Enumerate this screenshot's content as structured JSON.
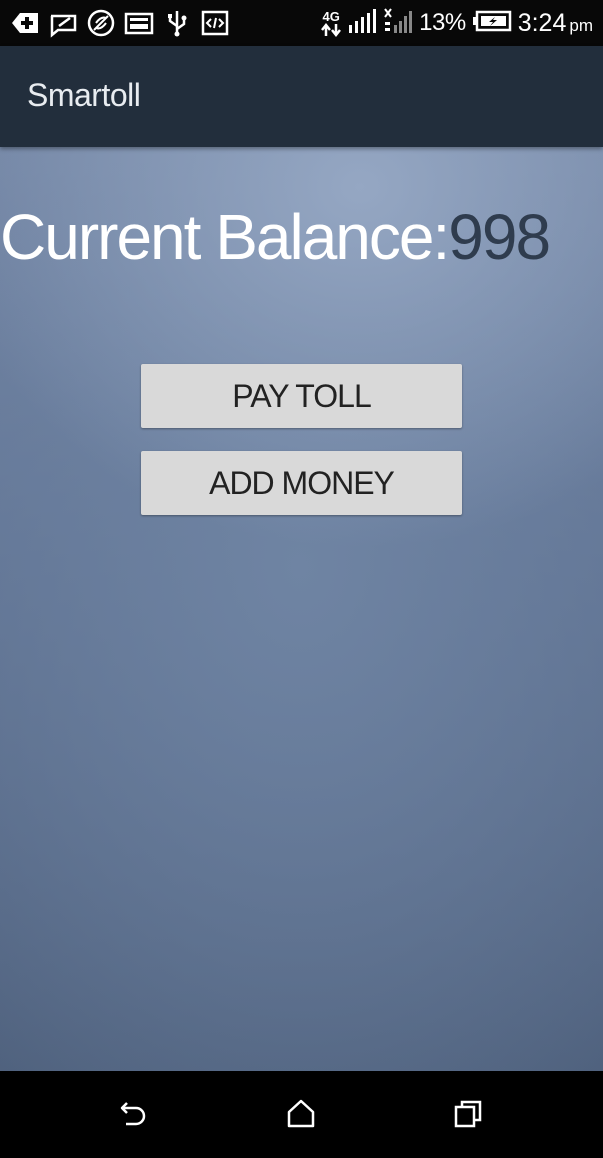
{
  "status_bar": {
    "network_type": "4G",
    "battery_percent": "13%",
    "time": "3:24",
    "ampm": "pm",
    "icons": [
      "add-notification-icon",
      "message-icon",
      "pinwheel-icon",
      "image-icon",
      "usb-icon",
      "code-icon",
      "data-arrows-icon",
      "signal-icon",
      "signal-icon-2",
      "battery-charging-icon"
    ]
  },
  "app_bar": {
    "title": "Smartoll"
  },
  "main": {
    "balance_label": "Current Balance:",
    "balance_value": "998",
    "pay_toll_label": "PAY TOLL",
    "add_money_label": "ADD MONEY"
  },
  "nav_bar": {
    "icons": [
      "back-icon",
      "home-icon",
      "recent-apps-icon"
    ]
  },
  "colors": {
    "app_bar": "#222e3c",
    "button_bg": "#d9d9d9",
    "balance_value": "#2f3c4e"
  }
}
